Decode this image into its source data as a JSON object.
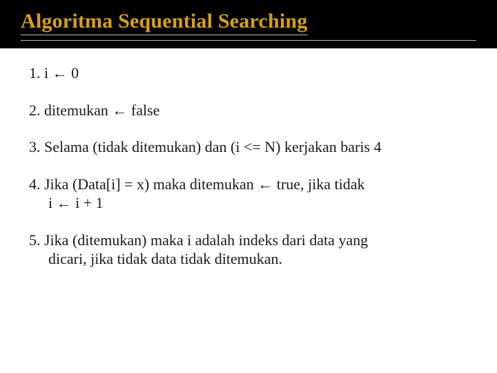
{
  "title": "Algoritma Sequential Searching",
  "steps": {
    "s1": "1. i ← 0",
    "s2": "2. ditemukan ← false",
    "s3": "3.  Selama (tidak ditemukan) dan (i <= N) kerjakan baris 4",
    "s4a": "4. Jika (Data[i] = x) maka ditemukan ← true, jika tidak",
    "s4b": "i ← i + 1",
    "s5a": "5. Jika (ditemukan) maka i adalah indeks dari data yang",
    "s5b": "dicari, jika tidak data tidak ditemukan."
  }
}
